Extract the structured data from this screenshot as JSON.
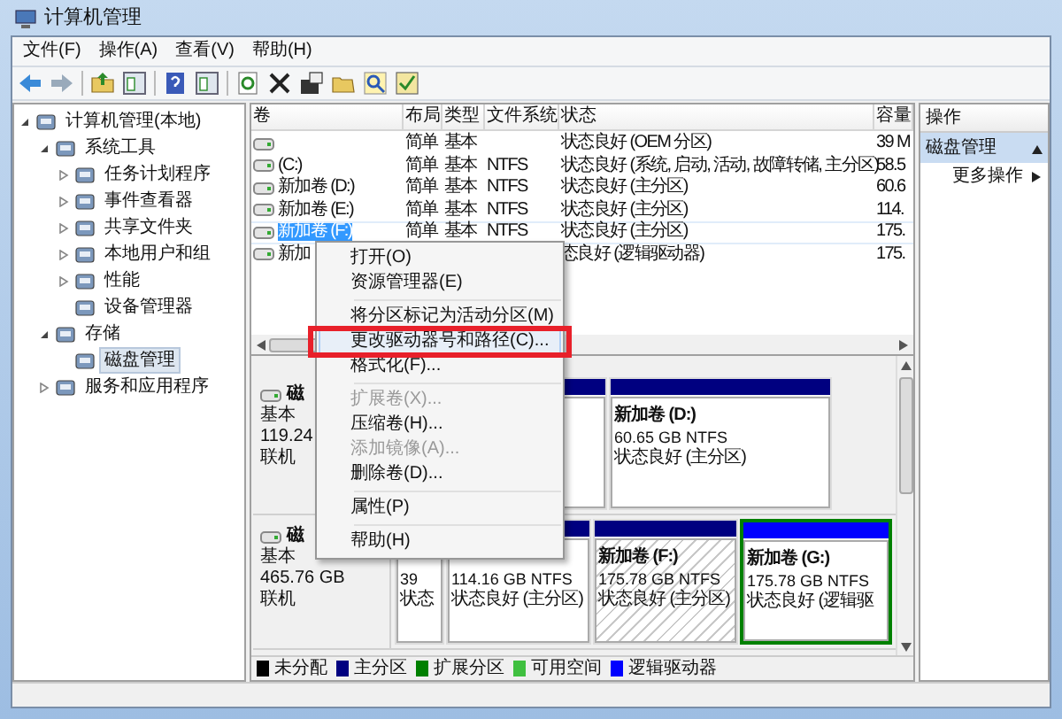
{
  "window": {
    "title": "计算机管理"
  },
  "menu_bar": [
    "文件(F)",
    "操作(A)",
    "查看(V)",
    "帮助(H)"
  ],
  "tree": [
    {
      "label": "计算机管理(本地)",
      "expanded": true,
      "selected": false,
      "children": [
        {
          "label": "系统工具",
          "expanded": true,
          "selected": false,
          "children": [
            {
              "label": "任务计划程序",
              "expanded": false,
              "selected": false
            },
            {
              "label": "事件查看器",
              "expanded": false,
              "selected": false
            },
            {
              "label": "共享文件夹",
              "expanded": false,
              "selected": false
            },
            {
              "label": "本地用户和组",
              "expanded": false,
              "selected": false
            },
            {
              "label": "性能",
              "expanded": false,
              "selected": false
            },
            {
              "label": "设备管理器",
              "selected": false
            }
          ]
        },
        {
          "label": "存储",
          "expanded": true,
          "selected": false,
          "children": [
            {
              "label": "磁盘管理",
              "selected": true
            }
          ]
        },
        {
          "label": "服务和应用程序",
          "expanded": false,
          "selected": false
        }
      ]
    }
  ],
  "volume_table": {
    "columns": [
      "卷",
      "布局",
      "类型",
      "文件系统",
      "状态",
      "容量"
    ],
    "rows": [
      {
        "selected": false,
        "cells": [
          "",
          "简单",
          "基本",
          "",
          "状态良好 (OEM 分区)",
          "39 M"
        ]
      },
      {
        "selected": false,
        "cells": [
          "(C:)",
          "简单",
          "基本",
          "NTFS",
          "状态良好 (系统, 启动, 活动, 故障转储, 主分区)",
          "58.5"
        ]
      },
      {
        "selected": false,
        "cells": [
          "新加卷 (D:)",
          "简单",
          "基本",
          "NTFS",
          "状态良好 (主分区)",
          "60.6"
        ]
      },
      {
        "selected": false,
        "cells": [
          "新加卷 (E:)",
          "简单",
          "基本",
          "NTFS",
          "状态良好 (主分区)",
          "114."
        ]
      },
      {
        "selected": true,
        "cells": [
          "新加卷 (F:)",
          "简单",
          "基本",
          "NTFS",
          "状态良好 (主分区)",
          "175."
        ]
      },
      {
        "selected": false,
        "cells": [
          "新加",
          "",
          "",
          "",
          "态良好 (逻辑驱动器)",
          "175."
        ]
      }
    ]
  },
  "disks": [
    {
      "name": "磁",
      "type": "基本",
      "size": "119.24",
      "status": "联机",
      "partitions": [
        {
          "kind": "primary",
          "selected": false
        },
        {
          "kind": "primary",
          "selected": false,
          "lines": [
            "新加卷  (D:)",
            "60.65 GB NTFS",
            "状态良好 (主分区)"
          ]
        }
      ]
    },
    {
      "name": "磁",
      "type": "基本",
      "size": "465.76 GB",
      "status": "联机",
      "partitions": [
        {
          "kind": "primary",
          "selected": false,
          "lines": [
            "39",
            "状态"
          ]
        },
        {
          "kind": "primary",
          "selected": false,
          "lines": [
            "114.16 GB NTFS",
            "状态良好 (主分区)"
          ]
        },
        {
          "kind": "hatched",
          "selected": false,
          "lines": [
            "新加卷  (F:)",
            "175.78 GB NTFS",
            "状态良好 (主分区)"
          ]
        },
        {
          "kind": "logical",
          "selected": true,
          "lines": [
            "新加卷  (G:)",
            "175.78 GB NTFS",
            "状态良好 (逻辑驱"
          ]
        }
      ]
    }
  ],
  "legend": [
    {
      "label": "未分配",
      "color": "#000000"
    },
    {
      "label": "主分区",
      "color": "#000080"
    },
    {
      "label": "扩展分区",
      "color": "#008000"
    },
    {
      "label": "可用空间",
      "color": "#40c040"
    },
    {
      "label": "逻辑驱动器",
      "color": "#0000ff"
    }
  ],
  "actions": {
    "title": "操作",
    "section": "磁盘管理",
    "items": [
      "更多操作"
    ]
  },
  "context_menu": [
    {
      "kind": "item",
      "label": "打开(O)",
      "disabled": false,
      "selected": false
    },
    {
      "kind": "item",
      "label": "资源管理器(E)",
      "disabled": false,
      "selected": false
    },
    {
      "kind": "separator"
    },
    {
      "kind": "item",
      "label": "将分区标记为活动分区(M)",
      "disabled": false,
      "selected": false
    },
    {
      "kind": "item",
      "label": "更改驱动器号和路径(C)...",
      "disabled": false,
      "selected": true
    },
    {
      "kind": "item",
      "label": "格式化(F)...",
      "disabled": false,
      "selected": false
    },
    {
      "kind": "separator"
    },
    {
      "kind": "item",
      "label": "扩展卷(X)...",
      "disabled": true,
      "selected": false
    },
    {
      "kind": "item",
      "label": "压缩卷(H)...",
      "disabled": false,
      "selected": false
    },
    {
      "kind": "item",
      "label": "添加镜像(A)...",
      "disabled": true,
      "selected": false
    },
    {
      "kind": "item",
      "label": "删除卷(D)...",
      "disabled": false,
      "selected": false
    },
    {
      "kind": "separator"
    },
    {
      "kind": "item",
      "label": "属性(P)",
      "disabled": false,
      "selected": false
    },
    {
      "kind": "separator"
    },
    {
      "kind": "item",
      "label": "帮助(H)",
      "disabled": false,
      "selected": false
    }
  ]
}
